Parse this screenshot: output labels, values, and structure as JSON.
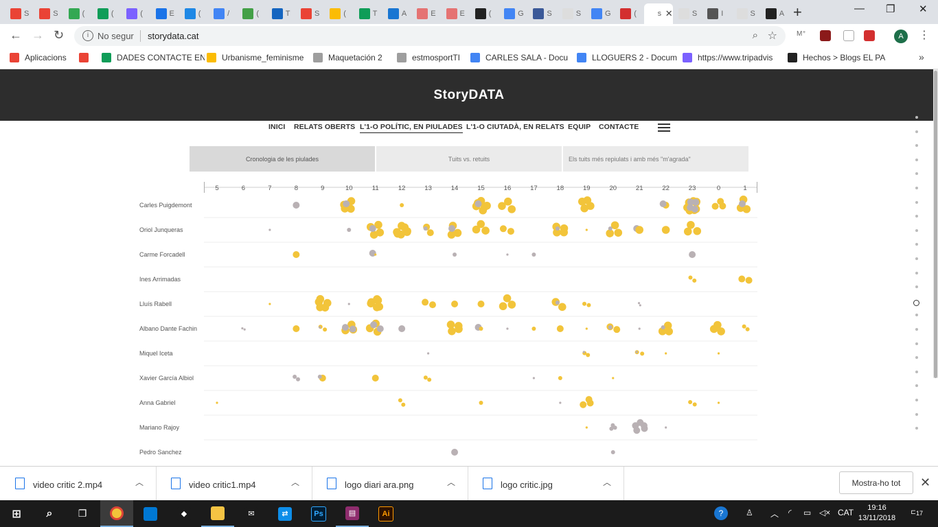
{
  "browser": {
    "tabs": [
      {
        "color": "#ea4335",
        "ttl": "S"
      },
      {
        "color": "#ea4335",
        "ttl": "S"
      },
      {
        "color": "#34a853",
        "ttl": "("
      },
      {
        "color": "#0f9d58",
        "ttl": "("
      },
      {
        "color": "#7b61ff",
        "ttl": "("
      },
      {
        "color": "#1a73e8",
        "ttl": "E"
      },
      {
        "color": "#1e88e5",
        "ttl": "("
      },
      {
        "color": "#4285f4",
        "ttl": "/"
      },
      {
        "color": "#43a047",
        "ttl": "("
      },
      {
        "color": "#1565c0",
        "ttl": "T"
      },
      {
        "color": "#ea4335",
        "ttl": "S"
      },
      {
        "color": "#fbbc04",
        "ttl": "("
      },
      {
        "color": "#0f9d58",
        "ttl": "T"
      },
      {
        "color": "#1976d2",
        "ttl": "A"
      },
      {
        "color": "#e57373",
        "ttl": "E"
      },
      {
        "color": "#e57373",
        "ttl": "E"
      },
      {
        "color": "#222222",
        "ttl": "("
      },
      {
        "color": "#4285f4",
        "ttl": "G"
      },
      {
        "color": "#3b5998",
        "ttl": "S"
      },
      {
        "color": "#dddddd",
        "ttl": "S"
      },
      {
        "color": "#4285f4",
        "ttl": "G"
      },
      {
        "color": "#d32f2f",
        "ttl": "("
      },
      {
        "color": "#ffffff",
        "ttl": "st",
        "active": true
      },
      {
        "color": "#dddddd",
        "ttl": "S"
      },
      {
        "color": "#555555",
        "ttl": "I"
      },
      {
        "color": "#dddddd",
        "ttl": "S"
      },
      {
        "color": "#222222",
        "ttl": "A"
      }
    ],
    "active_tab_title": "st",
    "url": "storydata.cat",
    "security_label": "No segur",
    "bookmarks": [
      {
        "label": "Aplicacions",
        "color": "#ea4335"
      },
      {
        "label": "",
        "color": "#ea4335"
      },
      {
        "label": "DADES CONTACTE EN",
        "color": "#0f9d58"
      },
      {
        "label": "Urbanisme_feminisme",
        "color": "#fbbc04"
      },
      {
        "label": "Maquetación 2",
        "color": "#9e9e9e"
      },
      {
        "label": "estmosportTI",
        "color": "#9e9e9e"
      },
      {
        "label": "CARLES SALA - Docu",
        "color": "#4285f4"
      },
      {
        "label": "LLOGUERS 2 - Docum",
        "color": "#4285f4"
      },
      {
        "label": "https://www.tripadvis",
        "color": "#7b61ff"
      },
      {
        "label": "Hechos > Blogs EL PA",
        "color": "#222222"
      }
    ],
    "avatar_letter": "A"
  },
  "site": {
    "logo": "StoryDATA",
    "nav": [
      "INICI",
      "RELATS OBERTS",
      "L'1-O POLÍTIC, EN PIULADES",
      "L'1-O CIUTADÀ, EN RELATS",
      "EQUIP",
      "CONTACTE"
    ],
    "active_nav": "L'1-O POLÍTIC, EN PIULADES",
    "subtabs": [
      "Cronologia de les piulades",
      "Tuits vs. retuits",
      "Els tuits més repiulats i amb més \"m'agrada\""
    ],
    "active_subtab": 0
  },
  "chart_data": {
    "type": "scatter",
    "hours": [
      "5",
      "6",
      "7",
      "8",
      "9",
      "10",
      "11",
      "12",
      "13",
      "14",
      "15",
      "16",
      "17",
      "18",
      "19",
      "20",
      "21",
      "22",
      "23",
      "0",
      "1"
    ],
    "politicians": [
      "Carles Puigdemont",
      "Oriol Junqueras",
      "Carme Forcadell",
      "Ines Arrimadas",
      "Lluís Rabell",
      "Albano Dante Fachin",
      "Miquel Iceta",
      "Xavier García Albiol",
      "Anna Gabriel",
      "Mariano Rajoy",
      "Pedro Sanchez"
    ],
    "legend_colors": {
      "tweet": "#f2c43a",
      "retweet": "#b9b1b4"
    },
    "points": [
      {
        "p": 0,
        "h": "8",
        "s": "m",
        "c": "g"
      },
      {
        "p": 0,
        "h": "10",
        "s": "l",
        "c": "y",
        "n": 4
      },
      {
        "p": 0,
        "h": "10",
        "s": "m",
        "c": "g"
      },
      {
        "p": 0,
        "h": "12",
        "s": "s",
        "c": "y"
      },
      {
        "p": 0,
        "h": "15",
        "s": "l",
        "c": "y",
        "n": 7
      },
      {
        "p": 0,
        "h": "15",
        "s": "m",
        "c": "g"
      },
      {
        "p": 0,
        "h": "16",
        "s": "l",
        "c": "y",
        "n": 3
      },
      {
        "p": 0,
        "h": "19",
        "s": "l",
        "c": "y",
        "n": 4
      },
      {
        "p": 0,
        "h": "22",
        "s": "m",
        "c": "y"
      },
      {
        "p": 0,
        "h": "22",
        "s": "m",
        "c": "g"
      },
      {
        "p": 0,
        "h": "23",
        "s": "l",
        "c": "y",
        "n": 8
      },
      {
        "p": 0,
        "h": "23",
        "s": "m",
        "c": "g",
        "n": 4
      },
      {
        "p": 0,
        "h": "0",
        "s": "m",
        "c": "y",
        "n": 3
      },
      {
        "p": 0,
        "h": "1",
        "s": "l",
        "c": "y",
        "n": 3
      },
      {
        "p": 0,
        "h": "1",
        "s": "m",
        "c": "g"
      },
      {
        "p": 1,
        "h": "7",
        "s": "xs",
        "c": "g"
      },
      {
        "p": 1,
        "h": "10",
        "s": "s",
        "c": "g"
      },
      {
        "p": 1,
        "h": "11",
        "s": "l",
        "c": "y",
        "n": 4
      },
      {
        "p": 1,
        "h": "11",
        "s": "m",
        "c": "g"
      },
      {
        "p": 1,
        "h": "12",
        "s": "l",
        "c": "y",
        "n": 7
      },
      {
        "p": 1,
        "h": "13",
        "s": "m",
        "c": "y",
        "n": 2
      },
      {
        "p": 1,
        "h": "13",
        "s": "s",
        "c": "g"
      },
      {
        "p": 1,
        "h": "14",
        "s": "l",
        "c": "y",
        "n": 3
      },
      {
        "p": 1,
        "h": "14",
        "s": "m",
        "c": "g"
      },
      {
        "p": 1,
        "h": "15",
        "s": "l",
        "c": "y",
        "n": 3
      },
      {
        "p": 1,
        "h": "16",
        "s": "m",
        "c": "y",
        "n": 2
      },
      {
        "p": 1,
        "h": "18",
        "s": "l",
        "c": "y",
        "n": 4
      },
      {
        "p": 1,
        "h": "18",
        "s": "s",
        "c": "g"
      },
      {
        "p": 1,
        "h": "19",
        "s": "xs",
        "c": "y"
      },
      {
        "p": 1,
        "h": "20",
        "s": "l",
        "c": "y",
        "n": 3
      },
      {
        "p": 1,
        "h": "20",
        "s": "s",
        "c": "g"
      },
      {
        "p": 1,
        "h": "21",
        "s": "m",
        "c": "g"
      },
      {
        "p": 1,
        "h": "21",
        "s": "l",
        "c": "y"
      },
      {
        "p": 1,
        "h": "22",
        "s": "l",
        "c": "y"
      },
      {
        "p": 1,
        "h": "23",
        "s": "l",
        "c": "y",
        "n": 3
      },
      {
        "p": 2,
        "h": "8",
        "s": "m",
        "c": "y"
      },
      {
        "p": 2,
        "h": "11",
        "s": "m",
        "c": "g"
      },
      {
        "p": 2,
        "h": "11",
        "s": "xs",
        "c": "y"
      },
      {
        "p": 2,
        "h": "14",
        "s": "s",
        "c": "g"
      },
      {
        "p": 2,
        "h": "16",
        "s": "xs",
        "c": "g"
      },
      {
        "p": 2,
        "h": "17",
        "s": "s",
        "c": "g"
      },
      {
        "p": 2,
        "h": "23",
        "s": "m",
        "c": "g"
      },
      {
        "p": 3,
        "h": "23",
        "s": "s",
        "c": "y",
        "n": 2
      },
      {
        "p": 3,
        "h": "1",
        "s": "m",
        "c": "y",
        "n": 2
      },
      {
        "p": 4,
        "h": "7",
        "s": "xs",
        "c": "y"
      },
      {
        "p": 4,
        "h": "9",
        "s": "l",
        "c": "y",
        "n": 5
      },
      {
        "p": 4,
        "h": "10",
        "s": "xs",
        "c": "g"
      },
      {
        "p": 4,
        "h": "11",
        "s": "l",
        "c": "y",
        "n": 6
      },
      {
        "p": 4,
        "h": "13",
        "s": "m",
        "c": "y",
        "n": 2
      },
      {
        "p": 4,
        "h": "14",
        "s": "m",
        "c": "y"
      },
      {
        "p": 4,
        "h": "15",
        "s": "m",
        "c": "y"
      },
      {
        "p": 4,
        "h": "16",
        "s": "l",
        "c": "y",
        "n": 3
      },
      {
        "p": 4,
        "h": "18",
        "s": "l",
        "c": "y",
        "n": 2
      },
      {
        "p": 4,
        "h": "18",
        "s": "s",
        "c": "g"
      },
      {
        "p": 4,
        "h": "19",
        "s": "s",
        "c": "y",
        "n": 2
      },
      {
        "p": 4,
        "h": "21",
        "s": "xs",
        "c": "g",
        "n": 2
      },
      {
        "p": 5,
        "h": "6",
        "s": "xs",
        "c": "g",
        "n": 2
      },
      {
        "p": 5,
        "h": "8",
        "s": "m",
        "c": "y"
      },
      {
        "p": 5,
        "h": "9",
        "s": "s",
        "c": "y",
        "n": 2
      },
      {
        "p": 5,
        "h": "9",
        "s": "xs",
        "c": "g"
      },
      {
        "p": 5,
        "h": "10",
        "s": "l",
        "c": "y",
        "n": 3
      },
      {
        "p": 5,
        "h": "10",
        "s": "m",
        "c": "g",
        "n": 2
      },
      {
        "p": 5,
        "h": "11",
        "s": "l",
        "c": "y",
        "n": 3
      },
      {
        "p": 5,
        "h": "11",
        "s": "m",
        "c": "g",
        "n": 2
      },
      {
        "p": 5,
        "h": "12",
        "s": "m",
        "c": "g"
      },
      {
        "p": 5,
        "h": "14",
        "s": "l",
        "c": "y",
        "n": 4
      },
      {
        "p": 5,
        "h": "15",
        "s": "m",
        "c": "g"
      },
      {
        "p": 5,
        "h": "15",
        "s": "s",
        "c": "y"
      },
      {
        "p": 5,
        "h": "16",
        "s": "xs",
        "c": "g"
      },
      {
        "p": 5,
        "h": "17",
        "s": "s",
        "c": "y"
      },
      {
        "p": 5,
        "h": "18",
        "s": "m",
        "c": "y"
      },
      {
        "p": 5,
        "h": "19",
        "s": "xs",
        "c": "y"
      },
      {
        "p": 5,
        "h": "20",
        "s": "m",
        "c": "y",
        "n": 2
      },
      {
        "p": 5,
        "h": "20",
        "s": "s",
        "c": "g"
      },
      {
        "p": 5,
        "h": "21",
        "s": "xs",
        "c": "g"
      },
      {
        "p": 5,
        "h": "22",
        "s": "l",
        "c": "y",
        "n": 3
      },
      {
        "p": 5,
        "h": "22",
        "s": "s",
        "c": "g"
      },
      {
        "p": 5,
        "h": "0",
        "s": "l",
        "c": "y",
        "n": 3
      },
      {
        "p": 5,
        "h": "1",
        "s": "s",
        "c": "y",
        "n": 2
      },
      {
        "p": 6,
        "h": "13",
        "s": "xs",
        "c": "g"
      },
      {
        "p": 6,
        "h": "19",
        "s": "s",
        "c": "y",
        "n": 2
      },
      {
        "p": 6,
        "h": "19",
        "s": "xs",
        "c": "g"
      },
      {
        "p": 6,
        "h": "21",
        "s": "s",
        "c": "y",
        "n": 2
      },
      {
        "p": 6,
        "h": "21",
        "s": "xs",
        "c": "g"
      },
      {
        "p": 6,
        "h": "22",
        "s": "xs",
        "c": "y"
      },
      {
        "p": 6,
        "h": "0",
        "s": "xs",
        "c": "y"
      },
      {
        "p": 7,
        "h": "8",
        "s": "s",
        "c": "g",
        "n": 2
      },
      {
        "p": 7,
        "h": "9",
        "s": "m",
        "c": "y"
      },
      {
        "p": 7,
        "h": "9",
        "s": "s",
        "c": "g"
      },
      {
        "p": 7,
        "h": "11",
        "s": "m",
        "c": "y"
      },
      {
        "p": 7,
        "h": "13",
        "s": "s",
        "c": "y",
        "n": 2
      },
      {
        "p": 7,
        "h": "17",
        "s": "xs",
        "c": "g"
      },
      {
        "p": 7,
        "h": "18",
        "s": "s",
        "c": "y"
      },
      {
        "p": 7,
        "h": "20",
        "s": "xs",
        "c": "y"
      },
      {
        "p": 8,
        "h": "5",
        "s": "xs",
        "c": "y"
      },
      {
        "p": 8,
        "h": "12",
        "s": "s",
        "c": "y",
        "n": 2
      },
      {
        "p": 8,
        "h": "15",
        "s": "s",
        "c": "y"
      },
      {
        "p": 8,
        "h": "18",
        "s": "xs",
        "c": "g"
      },
      {
        "p": 8,
        "h": "19",
        "s": "m",
        "c": "y",
        "n": 3
      },
      {
        "p": 8,
        "h": "23",
        "s": "s",
        "c": "y",
        "n": 2
      },
      {
        "p": 8,
        "h": "0",
        "s": "xs",
        "c": "y"
      },
      {
        "p": 9,
        "h": "19",
        "s": "xs",
        "c": "y"
      },
      {
        "p": 9,
        "h": "20",
        "s": "s",
        "c": "g",
        "n": 3
      },
      {
        "p": 9,
        "h": "21",
        "s": "m",
        "c": "g",
        "n": 5
      },
      {
        "p": 9,
        "h": "22",
        "s": "xs",
        "c": "g"
      },
      {
        "p": 10,
        "h": "14",
        "s": "m",
        "c": "g"
      },
      {
        "p": 10,
        "h": "20",
        "s": "s",
        "c": "g"
      }
    ]
  },
  "downloads": [
    {
      "name": "video critic 2.mp4"
    },
    {
      "name": "video critic1.mp4"
    },
    {
      "name": "logo diari ara.png"
    },
    {
      "name": "logo critic.jpg"
    }
  ],
  "downloads_show_all": "Mostra-ho tot",
  "taskbar": {
    "apps": [
      {
        "name": "chrome",
        "color": "#f2c43a",
        "glyph": "",
        "active": true
      },
      {
        "name": "store",
        "color": "#0078d4",
        "glyph": ""
      },
      {
        "name": "dropbox",
        "color": "#1b1b1b",
        "glyph": "◆"
      },
      {
        "name": "explorer",
        "color": "#f5c343",
        "glyph": ""
      },
      {
        "name": "mail",
        "color": "#1b1b1b",
        "glyph": "✉"
      },
      {
        "name": "teamviewer",
        "color": "#0e8ee9",
        "glyph": "⇄"
      },
      {
        "name": "photoshop",
        "color": "#001d34",
        "glyph": "Ps"
      },
      {
        "name": "winrar",
        "color": "#8e2c6d",
        "glyph": "▤"
      },
      {
        "name": "illustrator",
        "color": "#2e1200",
        "glyph": "Ai"
      }
    ],
    "language": "CAT",
    "time": "19:16",
    "date": "13/11/2018",
    "notifications": "17"
  }
}
